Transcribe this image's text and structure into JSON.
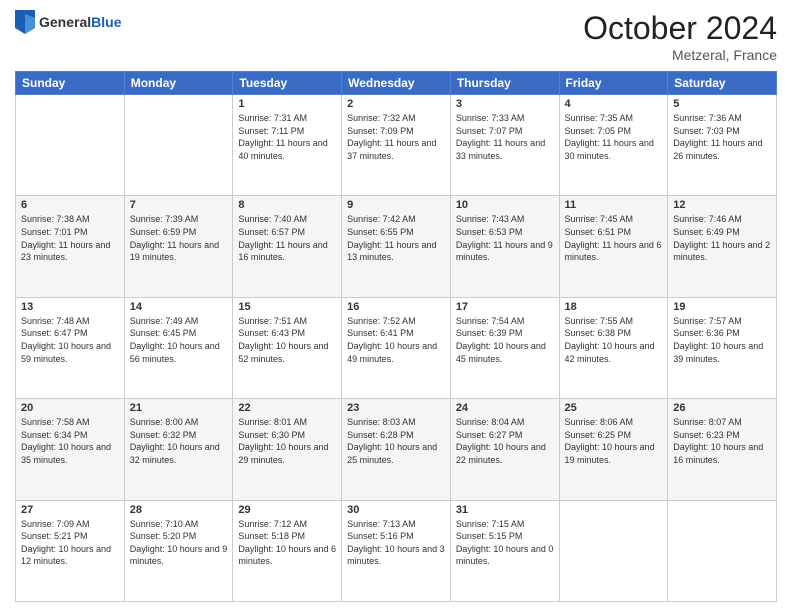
{
  "header": {
    "logo_general": "General",
    "logo_blue": "Blue",
    "month_title": "October 2024",
    "location": "Metzeral, France"
  },
  "days_of_week": [
    "Sunday",
    "Monday",
    "Tuesday",
    "Wednesday",
    "Thursday",
    "Friday",
    "Saturday"
  ],
  "weeks": [
    [
      {
        "day": "",
        "info": ""
      },
      {
        "day": "",
        "info": ""
      },
      {
        "day": "1",
        "info": "Sunrise: 7:31 AM\nSunset: 7:11 PM\nDaylight: 11 hours and 40 minutes."
      },
      {
        "day": "2",
        "info": "Sunrise: 7:32 AM\nSunset: 7:09 PM\nDaylight: 11 hours and 37 minutes."
      },
      {
        "day": "3",
        "info": "Sunrise: 7:33 AM\nSunset: 7:07 PM\nDaylight: 11 hours and 33 minutes."
      },
      {
        "day": "4",
        "info": "Sunrise: 7:35 AM\nSunset: 7:05 PM\nDaylight: 11 hours and 30 minutes."
      },
      {
        "day": "5",
        "info": "Sunrise: 7:36 AM\nSunset: 7:03 PM\nDaylight: 11 hours and 26 minutes."
      }
    ],
    [
      {
        "day": "6",
        "info": "Sunrise: 7:38 AM\nSunset: 7:01 PM\nDaylight: 11 hours and 23 minutes."
      },
      {
        "day": "7",
        "info": "Sunrise: 7:39 AM\nSunset: 6:59 PM\nDaylight: 11 hours and 19 minutes."
      },
      {
        "day": "8",
        "info": "Sunrise: 7:40 AM\nSunset: 6:57 PM\nDaylight: 11 hours and 16 minutes."
      },
      {
        "day": "9",
        "info": "Sunrise: 7:42 AM\nSunset: 6:55 PM\nDaylight: 11 hours and 13 minutes."
      },
      {
        "day": "10",
        "info": "Sunrise: 7:43 AM\nSunset: 6:53 PM\nDaylight: 11 hours and 9 minutes."
      },
      {
        "day": "11",
        "info": "Sunrise: 7:45 AM\nSunset: 6:51 PM\nDaylight: 11 hours and 6 minutes."
      },
      {
        "day": "12",
        "info": "Sunrise: 7:46 AM\nSunset: 6:49 PM\nDaylight: 11 hours and 2 minutes."
      }
    ],
    [
      {
        "day": "13",
        "info": "Sunrise: 7:48 AM\nSunset: 6:47 PM\nDaylight: 10 hours and 59 minutes."
      },
      {
        "day": "14",
        "info": "Sunrise: 7:49 AM\nSunset: 6:45 PM\nDaylight: 10 hours and 56 minutes."
      },
      {
        "day": "15",
        "info": "Sunrise: 7:51 AM\nSunset: 6:43 PM\nDaylight: 10 hours and 52 minutes."
      },
      {
        "day": "16",
        "info": "Sunrise: 7:52 AM\nSunset: 6:41 PM\nDaylight: 10 hours and 49 minutes."
      },
      {
        "day": "17",
        "info": "Sunrise: 7:54 AM\nSunset: 6:39 PM\nDaylight: 10 hours and 45 minutes."
      },
      {
        "day": "18",
        "info": "Sunrise: 7:55 AM\nSunset: 6:38 PM\nDaylight: 10 hours and 42 minutes."
      },
      {
        "day": "19",
        "info": "Sunrise: 7:57 AM\nSunset: 6:36 PM\nDaylight: 10 hours and 39 minutes."
      }
    ],
    [
      {
        "day": "20",
        "info": "Sunrise: 7:58 AM\nSunset: 6:34 PM\nDaylight: 10 hours and 35 minutes."
      },
      {
        "day": "21",
        "info": "Sunrise: 8:00 AM\nSunset: 6:32 PM\nDaylight: 10 hours and 32 minutes."
      },
      {
        "day": "22",
        "info": "Sunrise: 8:01 AM\nSunset: 6:30 PM\nDaylight: 10 hours and 29 minutes."
      },
      {
        "day": "23",
        "info": "Sunrise: 8:03 AM\nSunset: 6:28 PM\nDaylight: 10 hours and 25 minutes."
      },
      {
        "day": "24",
        "info": "Sunrise: 8:04 AM\nSunset: 6:27 PM\nDaylight: 10 hours and 22 minutes."
      },
      {
        "day": "25",
        "info": "Sunrise: 8:06 AM\nSunset: 6:25 PM\nDaylight: 10 hours and 19 minutes."
      },
      {
        "day": "26",
        "info": "Sunrise: 8:07 AM\nSunset: 6:23 PM\nDaylight: 10 hours and 16 minutes."
      }
    ],
    [
      {
        "day": "27",
        "info": "Sunrise: 7:09 AM\nSunset: 5:21 PM\nDaylight: 10 hours and 12 minutes."
      },
      {
        "day": "28",
        "info": "Sunrise: 7:10 AM\nSunset: 5:20 PM\nDaylight: 10 hours and 9 minutes."
      },
      {
        "day": "29",
        "info": "Sunrise: 7:12 AM\nSunset: 5:18 PM\nDaylight: 10 hours and 6 minutes."
      },
      {
        "day": "30",
        "info": "Sunrise: 7:13 AM\nSunset: 5:16 PM\nDaylight: 10 hours and 3 minutes."
      },
      {
        "day": "31",
        "info": "Sunrise: 7:15 AM\nSunset: 5:15 PM\nDaylight: 10 hours and 0 minutes."
      },
      {
        "day": "",
        "info": ""
      },
      {
        "day": "",
        "info": ""
      }
    ]
  ]
}
